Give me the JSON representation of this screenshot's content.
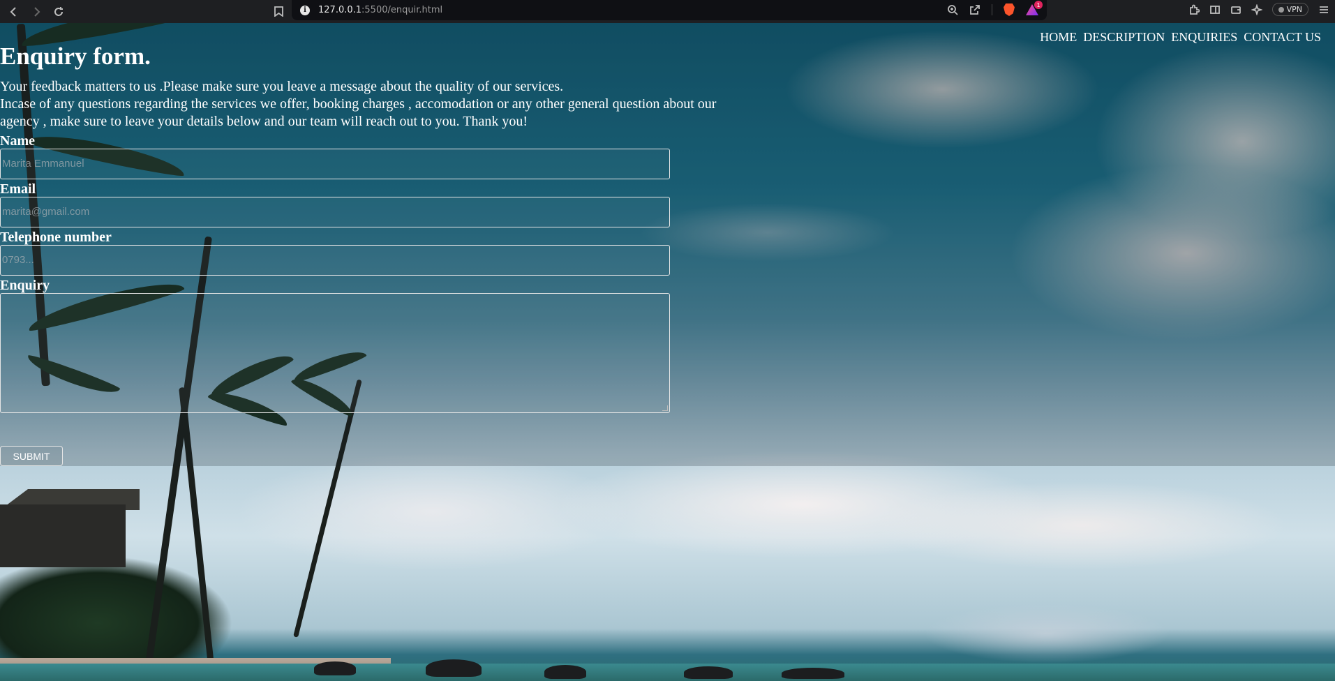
{
  "browser": {
    "url_host": "127.0.0.1",
    "url_path": ":5500/enquir.html",
    "notification_count": "1",
    "vpn_label": "VPN"
  },
  "nav": {
    "items": [
      "HOME",
      "DESCRIPTION",
      "ENQUIRIES",
      "CONTACT US"
    ]
  },
  "form": {
    "title": "Enquiry form.",
    "intro_line1": "Your feedback matters to us .Please make sure you leave a message about the quality of our services.",
    "intro_line2": "Incase of any questions regarding the services we offer, booking charges , accomodation or any other general question about our agency , make sure to leave your details below and our team will reach out to you. Thank you!",
    "name_label": "Name",
    "name_placeholder": "Marita Emmanuel",
    "email_label": "Email",
    "email_placeholder": "marita@gmail.com",
    "phone_label": "Telephone number",
    "phone_placeholder": "0793...",
    "enquiry_label": "Enquiry",
    "enquiry_value": "",
    "submit_label": "SUBMIT"
  }
}
